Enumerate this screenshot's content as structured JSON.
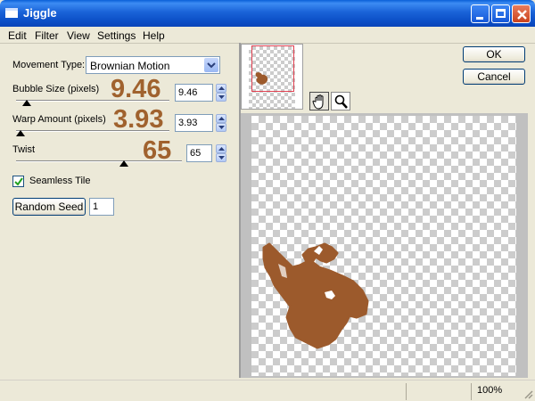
{
  "window": {
    "title": "Jiggle"
  },
  "menu": [
    "Edit",
    "Filter",
    "View",
    "Settings",
    "Help"
  ],
  "movement": {
    "label": "Movement Type:",
    "value": "Brownian Motion"
  },
  "bubble": {
    "label": "Bubble Size (pixels)",
    "big": "9.46",
    "value": "9.46",
    "slider_fraction": 0.07
  },
  "warp": {
    "label": "Warp Amount (pixels)",
    "big": "3.93",
    "value": "3.93",
    "slider_fraction": 0.03
  },
  "twist": {
    "label": "Twist",
    "big": "65",
    "value": "65",
    "slider_fraction": 0.65
  },
  "seamless": {
    "label": "Seamless Tile",
    "checked": true
  },
  "random_seed": {
    "label": "Random Seed",
    "value": "1"
  },
  "buttons": {
    "ok": "OK",
    "cancel": "Cancel"
  },
  "status": {
    "zoom": "100%"
  },
  "colors": {
    "accent_number": "#a0622e",
    "blob": "#9c5a2c",
    "thumb_frame": "#e04050"
  },
  "icons": {
    "hand": "hand-pan-icon",
    "zoom": "magnifier-icon"
  }
}
